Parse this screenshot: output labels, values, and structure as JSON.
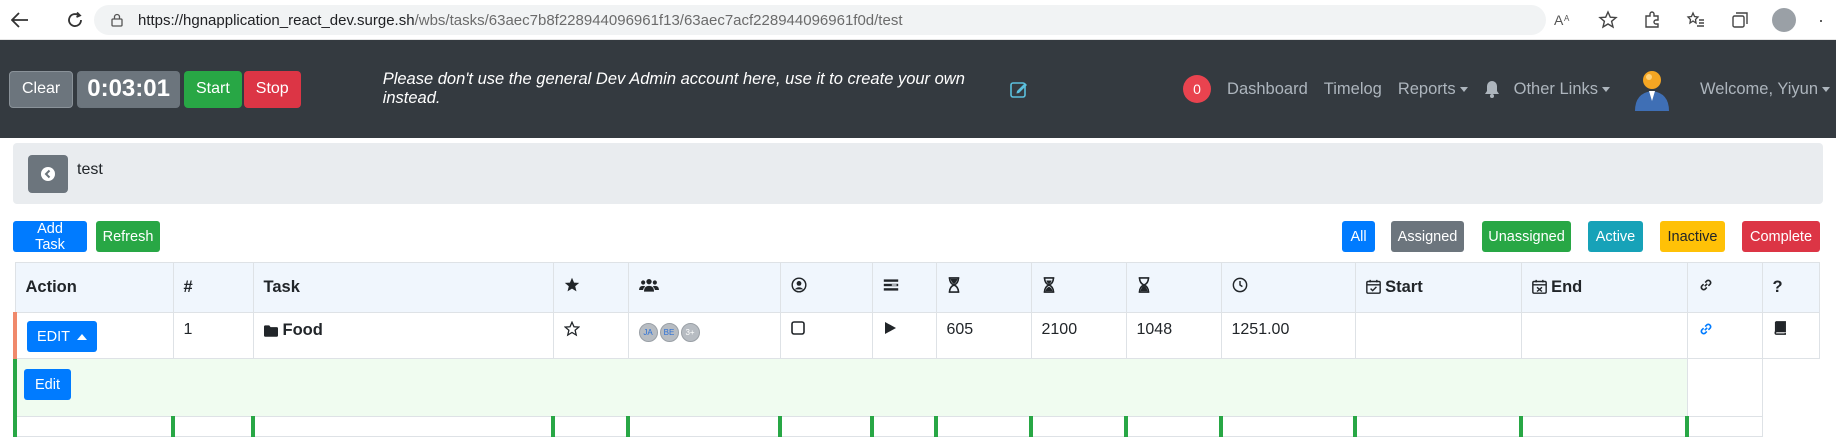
{
  "browser": {
    "url_host": "https://hgnapplication_react_dev.surge.sh",
    "url_path": "/wbs/tasks/63aec7b8f228944096961f13/63aec7acf228944096961f0d/test"
  },
  "header": {
    "clear_label": "Clear",
    "timer": "0:03:01",
    "start_label": "Start",
    "stop_label": "Stop",
    "message": "Please don't use the general Dev Admin account here, use it to create your own instead.",
    "notification_count": "0",
    "nav": {
      "dashboard": "Dashboard",
      "timelog": "Timelog",
      "reports": "Reports",
      "other_links": "Other Links",
      "welcome": "Welcome, Yiyun"
    }
  },
  "breadcrumb": {
    "title": "test"
  },
  "toolbar": {
    "add_task": "Add Task",
    "refresh": "Refresh",
    "filters": {
      "all": "All",
      "assigned": "Assigned",
      "unassigned": "Unassigned",
      "active": "Active",
      "inactive": "Inactive",
      "complete": "Complete"
    }
  },
  "table": {
    "headers": {
      "action": "Action",
      "num": "#",
      "task": "Task",
      "start": "Start",
      "end": "End",
      "help": "?"
    },
    "rows": [
      {
        "edit_label": "EDIT",
        "num": "1",
        "task": "Food",
        "avatars": [
          "JA",
          "BE",
          "3+"
        ],
        "hours_1": "605",
        "hours_2": "2100",
        "hours_3": "1048",
        "hours_4": "1251.00",
        "start": "",
        "end": ""
      }
    ],
    "detail_edit_label": "Edit"
  },
  "colors": {
    "header_bg": "#343a40",
    "primary": "#007bff",
    "success": "#28a745",
    "danger": "#dc3545",
    "warning": "#ffc107",
    "info": "#17a2b8",
    "secondary": "#6c757d"
  }
}
